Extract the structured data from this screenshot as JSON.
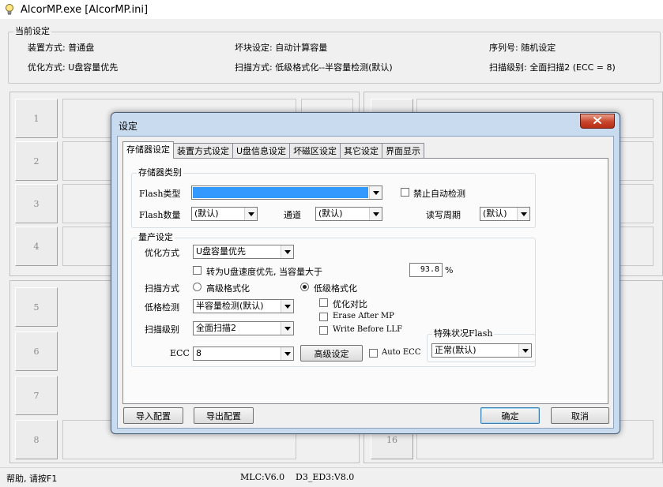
{
  "window": {
    "title": "AlcorMP.exe [AlcorMP.ini]"
  },
  "current_settings": {
    "legend": "当前设定",
    "device_mode": "装置方式: 普通盘",
    "bad_block": "坏块设定: 自动计算容量",
    "serial": "序列号: 随机设定",
    "optimize": "优化方式: U盘容量优先",
    "scan_mode": "扫描方式: 低级格式化--半容量检测(默认)",
    "scan_level": "扫描级别: 全面扫描2 (ECC = 8)"
  },
  "slots": {
    "left_top": [
      "1",
      "2",
      "3",
      "4"
    ],
    "left_bottom": [
      "5",
      "6",
      "7",
      "8"
    ],
    "right_bottom_last": "16"
  },
  "statusbar": {
    "help": "帮助, 请按F1",
    "mlc": "MLC:V6.0",
    "d3": "D3_ED3:V8.0"
  },
  "dialog": {
    "title": "设定",
    "tabs": [
      "存储器设定",
      "装置方式设定",
      "U盘信息设定",
      "坏磁区设定",
      "其它设定",
      "界面显示"
    ],
    "active_tab": "存储器设定",
    "storage_group": {
      "legend": "存储器类别",
      "flash_type_label": "Flash类型",
      "flash_type_value": "",
      "disable_auto_detect": "禁止自动检测",
      "flash_count_label": "Flash数量",
      "flash_count_value": "(默认)",
      "channel_label": "通道",
      "channel_value": "(默认)",
      "rw_cycle_label": "读写周期",
      "rw_cycle_value": "(默认)"
    },
    "production_group": {
      "legend": "量产设定",
      "optimize_label": "优化方式",
      "optimize_value": "U盘容量优先",
      "speed_priority_label": "转为U盘速度优先, 当容量大于",
      "speed_priority_value": "93.8",
      "percent": "%",
      "scan_mode_label": "扫描方式",
      "high_format": "高级格式化",
      "low_format": "低级格式化",
      "low_check_label": "低格检测",
      "low_check_value": "半容量检测(默认)",
      "optimize_compare": "优化对比",
      "erase_after_mp": "Erase After MP",
      "write_before_llf": "Write Before LLF",
      "scan_level_label": "扫描级别",
      "scan_level_value": "全面扫描2",
      "ecc_label": "ECC",
      "ecc_value": "8",
      "advanced_button": "高级设定",
      "auto_ecc": "Auto ECC"
    },
    "special_flash": {
      "legend": "特殊状况Flash",
      "value": "正常(默认)"
    },
    "buttons": {
      "import": "导入配置",
      "export": "导出配置",
      "ok": "确定",
      "cancel": "取消"
    }
  },
  "colors": {
    "selection": "#3399ff",
    "close_button": "#c8452b",
    "dialog_frame": "#c9dbef"
  }
}
